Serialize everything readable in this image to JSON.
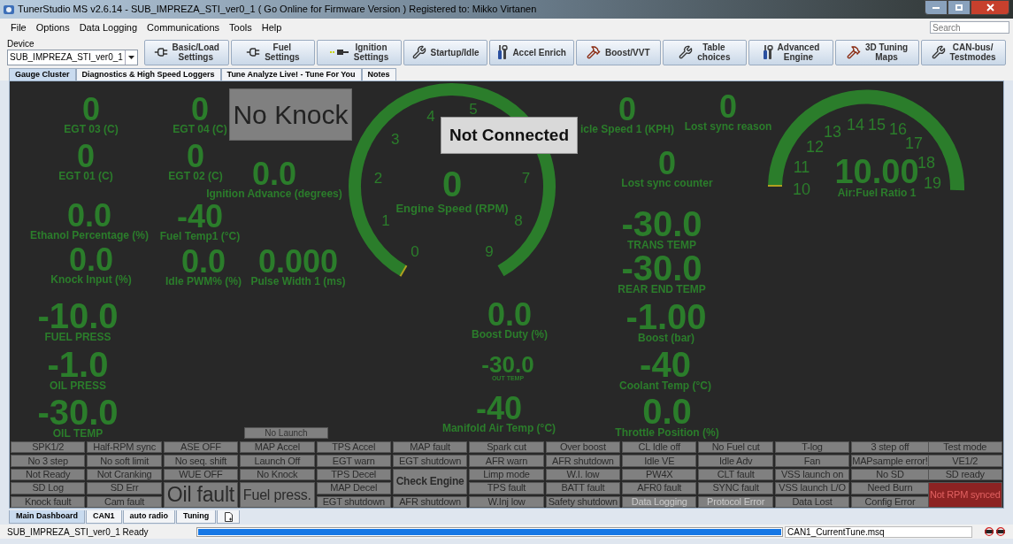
{
  "window": {
    "title": "TunerStudio MS v2.6.14 - SUB_IMPREZA_STI_ver0_1 ( Go Online for Firmware Version ) Registered to: Mikko Virtanen"
  },
  "menu": [
    "File",
    "Options",
    "Data Logging",
    "Communications",
    "Tools",
    "Help"
  ],
  "search": {
    "placeholder": "Search"
  },
  "device": {
    "label": "Device",
    "value": "SUB_IMPREZA_STI_ver0_1"
  },
  "toolbar": [
    "Basic/Load\nSettings",
    "Fuel\nSettings",
    "Ignition\nSettings",
    "Startup/Idle",
    "Accel Enrich",
    "Boost/VVT",
    "Table\nchoices",
    "Advanced\nEngine",
    "3D Tuning\nMaps",
    "CAN-bus/\nTestmodes"
  ],
  "tabs": [
    {
      "label": "Gauge Cluster",
      "selected": true
    },
    {
      "label": "Diagnostics & High Speed Loggers",
      "selected": false
    },
    {
      "label": "Tune Analyze Live! - Tune For You",
      "selected": false
    },
    {
      "label": "Notes",
      "selected": false
    }
  ],
  "readouts": [
    {
      "value": "0",
      "label": "EGT 03 (C)"
    },
    {
      "value": "0",
      "label": "EGT 04 (C)"
    },
    {
      "value": "0",
      "label": "EGT 01 (C)"
    },
    {
      "value": "0",
      "label": "EGT 02 (C)"
    },
    {
      "value": "0.0",
      "label": "Ignition Advance (degrees)"
    },
    {
      "value": "0.0",
      "label": "Ethanol Percentage (%)"
    },
    {
      "value": "-40",
      "label": "Fuel Temp1 (°C)"
    },
    {
      "value": "0.0",
      "label": "Knock Input (%)"
    },
    {
      "value": "0.0",
      "label": "Idle PWM% (%)"
    },
    {
      "value": "0.000",
      "label": "Pulse Width 1 (ms)"
    },
    {
      "value": "-10.0",
      "label": "FUEL PRESS"
    },
    {
      "value": "-1.0",
      "label": "OIL PRESS"
    },
    {
      "value": "-30.0",
      "label": "OIL TEMP"
    },
    {
      "value": "0",
      "label": "icle Speed 1 (KPH)"
    },
    {
      "value": "0",
      "label": "Lost sync reason"
    },
    {
      "value": "0",
      "label": "Lost sync counter"
    },
    {
      "value": "-30.0",
      "label": "TRANS TEMP"
    },
    {
      "value": "-30.0",
      "label": "REAR END TEMP"
    },
    {
      "value": "-1.00",
      "label": "Boost (bar)"
    },
    {
      "value": "-40",
      "label": "Coolant Temp (°C)"
    },
    {
      "value": "0.0",
      "label": "Throttle Position (%)"
    },
    {
      "value": "0.0",
      "label": "Boost Duty (%)"
    },
    {
      "value": "-30.0",
      "label": "OUT TEMP"
    },
    {
      "value": "-40",
      "label": "Manifold Air Temp (°C)"
    }
  ],
  "rpm_gauge": {
    "value": "0",
    "label": "Engine Speed (RPM)",
    "ticks": [
      "0",
      "1",
      "2",
      "3",
      "4",
      "5",
      "7",
      "8",
      "9"
    ]
  },
  "afr_gauge": {
    "value": "10.00",
    "label": "Air:Fuel Ratio 1",
    "ticks": [
      "10",
      "11",
      "12",
      "13",
      "14",
      "15",
      "16",
      "17",
      "18",
      "19"
    ]
  },
  "knock_indicator": {
    "label": "No Knock"
  },
  "connection_overlay": {
    "label": "Not Connected"
  },
  "launch_indicator": {
    "label": "No Launch"
  },
  "indicators": [
    [
      {
        "label": "SPK1/2",
        "kind": "lamp",
        "alarm": false,
        "disabled": false
      },
      {
        "label": "No 3 step",
        "kind": "lamp",
        "alarm": false,
        "disabled": false
      },
      {
        "label": "Not Ready",
        "kind": "lamp",
        "alarm": false,
        "disabled": false
      },
      {
        "label": "SD Log",
        "kind": "lamp",
        "alarm": false,
        "disabled": false
      },
      {
        "label": "Knock fault",
        "kind": "lamp",
        "alarm": false,
        "disabled": false
      }
    ],
    [
      {
        "label": "Half-RPM sync",
        "kind": "lamp",
        "alarm": false,
        "disabled": false
      },
      {
        "label": "No soft limit",
        "kind": "lamp",
        "alarm": false,
        "disabled": false
      },
      {
        "label": "Not Cranking",
        "kind": "lamp",
        "alarm": false,
        "disabled": false
      },
      {
        "label": "SD Err",
        "kind": "lamp",
        "alarm": false,
        "disabled": false
      },
      {
        "label": "Cam fault",
        "kind": "lamp",
        "alarm": false,
        "disabled": false
      }
    ],
    [
      {
        "label": "ASE OFF",
        "kind": "lamp",
        "alarm": false,
        "disabled": false
      },
      {
        "label": "No seq. shift",
        "kind": "lamp",
        "alarm": false,
        "disabled": false
      },
      {
        "label": "WUE OFF",
        "kind": "lamp",
        "alarm": false,
        "disabled": false
      },
      {
        "label": "Oil fault",
        "kind": "huge",
        "alarm": false,
        "disabled": false
      }
    ],
    [
      {
        "label": "MAP Accel",
        "kind": "lamp",
        "alarm": false,
        "disabled": false
      },
      {
        "label": "Launch Off",
        "kind": "lamp",
        "alarm": false,
        "disabled": false
      },
      {
        "label": "No Knock",
        "kind": "lamp",
        "alarm": false,
        "disabled": false
      },
      {
        "label": "Fuel press.",
        "kind": "large",
        "alarm": false,
        "disabled": false
      }
    ],
    [
      {
        "label": "TPS Accel",
        "kind": "lamp",
        "alarm": false,
        "disabled": false
      },
      {
        "label": "EGT warn",
        "kind": "lamp",
        "alarm": false,
        "disabled": false
      },
      {
        "label": "TPS Decel",
        "kind": "lamp",
        "alarm": false,
        "disabled": false
      },
      {
        "label": "MAP Decel",
        "kind": "lamp",
        "alarm": false,
        "disabled": false
      },
      {
        "label": "EGT shutdown",
        "kind": "lamp",
        "alarm": false,
        "disabled": false
      }
    ],
    [
      {
        "label": "MAP fault",
        "kind": "lamp",
        "alarm": false,
        "disabled": false
      },
      {
        "label": "EGT shutdown",
        "kind": "lamp",
        "alarm": false,
        "disabled": false
      },
      {
        "label": "Check Engine",
        "kind": "bold",
        "alarm": false,
        "disabled": false
      },
      {
        "label": "AFR shutdown",
        "kind": "lamp",
        "alarm": false,
        "disabled": false
      }
    ],
    [
      {
        "label": "Spark cut",
        "kind": "lamp",
        "alarm": false,
        "disabled": false
      },
      {
        "label": "AFR warn",
        "kind": "lamp",
        "alarm": false,
        "disabled": false
      },
      {
        "label": "Limp mode",
        "kind": "lamp",
        "alarm": false,
        "disabled": false
      },
      {
        "label": "TPS fault",
        "kind": "lamp",
        "alarm": false,
        "disabled": false
      },
      {
        "label": "W.Inj low",
        "kind": "lamp",
        "alarm": false,
        "disabled": false
      }
    ],
    [
      {
        "label": "Over boost",
        "kind": "lamp",
        "alarm": false,
        "disabled": false
      },
      {
        "label": "AFR shutdown",
        "kind": "lamp",
        "alarm": false,
        "disabled": false
      },
      {
        "label": "W.I. low",
        "kind": "lamp",
        "alarm": false,
        "disabled": false
      },
      {
        "label": "BATT fault",
        "kind": "lamp",
        "alarm": false,
        "disabled": false
      },
      {
        "label": "Safety shutdown",
        "kind": "lamp",
        "alarm": false,
        "disabled": false
      }
    ],
    [
      {
        "label": "CL Idle off",
        "kind": "lamp",
        "alarm": false,
        "disabled": false
      },
      {
        "label": "Idle VE",
        "kind": "lamp",
        "alarm": false,
        "disabled": false
      },
      {
        "label": "PW4X",
        "kind": "lamp",
        "alarm": false,
        "disabled": false
      },
      {
        "label": "AFR0 fault",
        "kind": "lamp",
        "alarm": false,
        "disabled": false
      },
      {
        "label": "Data Logging",
        "kind": "lamp",
        "alarm": false,
        "disabled": true
      }
    ],
    [
      {
        "label": "No Fuel cut",
        "kind": "lamp",
        "alarm": false,
        "disabled": false
      },
      {
        "label": "Idle Adv",
        "kind": "lamp",
        "alarm": false,
        "disabled": false
      },
      {
        "label": "CLT fault",
        "kind": "lamp",
        "alarm": false,
        "disabled": false
      },
      {
        "label": "SYNC fault",
        "kind": "lamp",
        "alarm": false,
        "disabled": false
      },
      {
        "label": "Protocol Error",
        "kind": "lamp",
        "alarm": false,
        "disabled": true
      }
    ],
    [
      {
        "label": "T-log",
        "kind": "lamp",
        "alarm": false,
        "disabled": false
      },
      {
        "label": "Fan",
        "kind": "lamp",
        "alarm": false,
        "disabled": false
      },
      {
        "label": "VSS launch on",
        "kind": "lamp",
        "alarm": false,
        "disabled": false
      },
      {
        "label": "VSS launch L/O",
        "kind": "lamp",
        "alarm": false,
        "disabled": false
      },
      {
        "label": "Data Lost",
        "kind": "lamp",
        "alarm": false,
        "disabled": false
      }
    ],
    [
      {
        "label": "3 step off",
        "kind": "lamp",
        "alarm": false,
        "disabled": false
      },
      {
        "label": "MAPsample error!",
        "kind": "lamp",
        "alarm": false,
        "disabled": false
      },
      {
        "label": "No SD",
        "kind": "lamp",
        "alarm": false,
        "disabled": false
      },
      {
        "label": "Need Burn",
        "kind": "lamp",
        "alarm": false,
        "disabled": false
      },
      {
        "label": "Config Error",
        "kind": "lamp",
        "alarm": false,
        "disabled": false
      }
    ],
    [
      {
        "label": "Test mode",
        "kind": "lamp",
        "alarm": false,
        "disabled": false
      },
      {
        "label": "VE1/2",
        "kind": "lamp",
        "alarm": false,
        "disabled": false
      },
      {
        "label": "SD ready",
        "kind": "lamp",
        "alarm": false,
        "disabled": false
      },
      {
        "label": "Not RPM synced",
        "kind": "tall",
        "alarm": true,
        "disabled": false
      }
    ]
  ],
  "bottom_tabs": [
    {
      "label": "Main Dashboard",
      "selected": true
    },
    {
      "label": "CAN1",
      "selected": false
    },
    {
      "label": "auto radio",
      "selected": false
    },
    {
      "label": "Tuning",
      "selected": false
    }
  ],
  "status_bar": {
    "message": "SUB_IMPREZA_STI_ver0_1 Ready",
    "level": 1,
    "file": "CAN1_CurrentTune.msq"
  }
}
